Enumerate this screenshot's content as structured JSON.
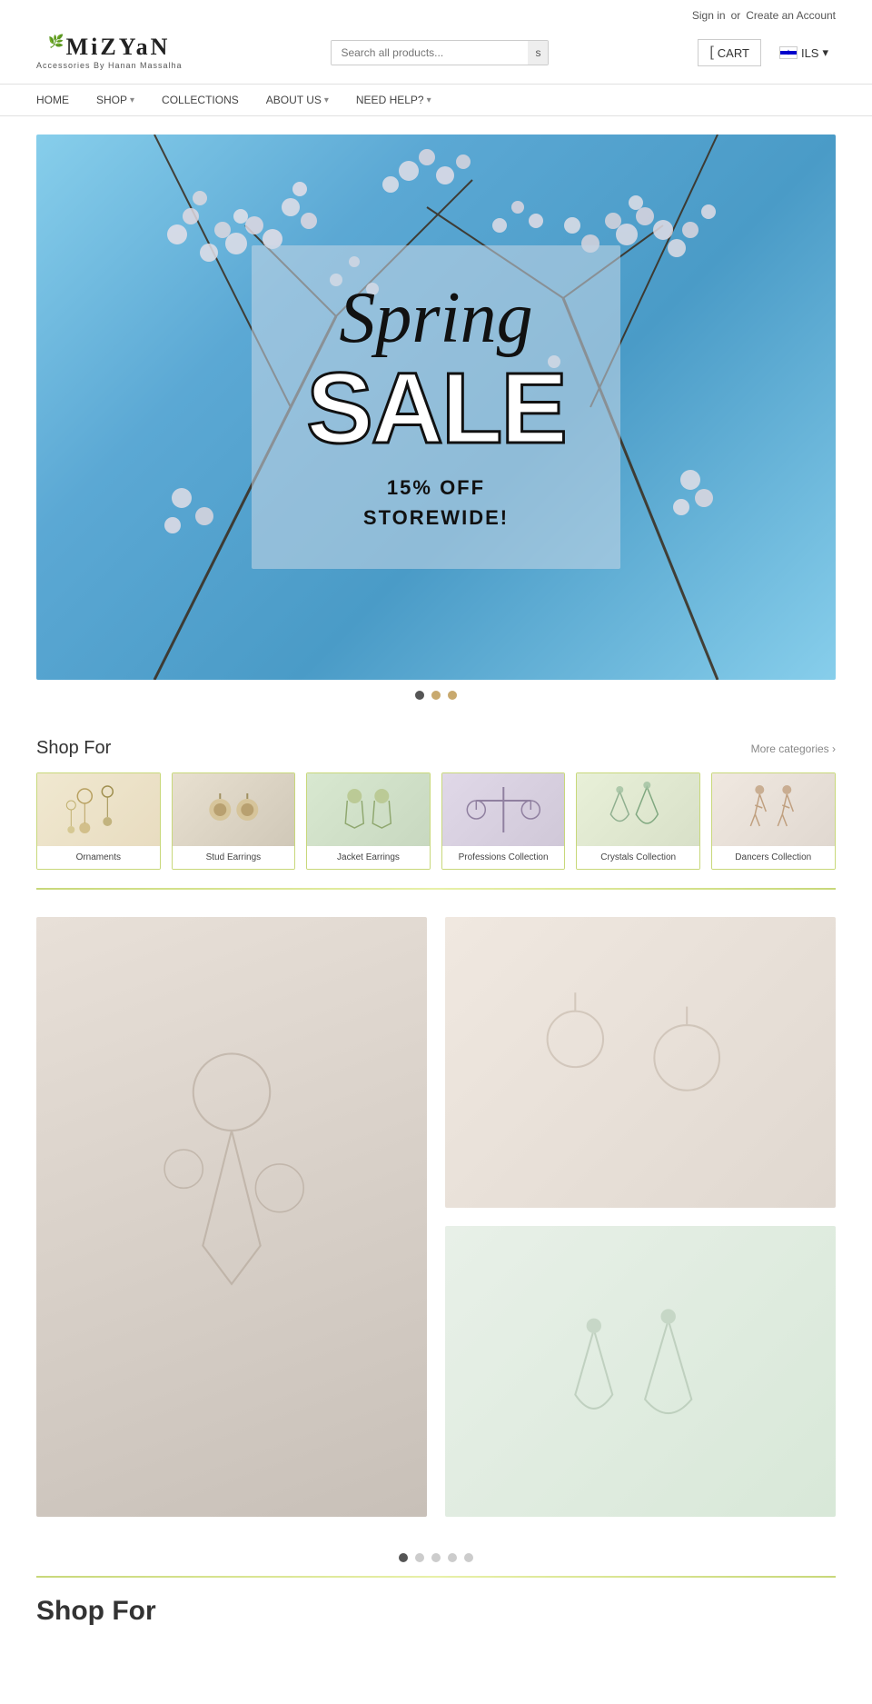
{
  "header": {
    "sign_in": "Sign in",
    "or": "or",
    "create_account": "Create an Account",
    "search_placeholder": "Search all products...",
    "search_btn": "s",
    "cart_label": "CART",
    "cart_bracket": "[",
    "lang_label": "ILS",
    "lang_arrow": "▾"
  },
  "logo": {
    "brand": "MiZYaN",
    "subtitle": "Accessories By Hanan Massalha",
    "leaf": "🌿"
  },
  "nav": {
    "items": [
      {
        "label": "HOME",
        "arrow": ""
      },
      {
        "label": "SHOP",
        "arrow": "▾"
      },
      {
        "label": "COLLECTIONS",
        "arrow": ""
      },
      {
        "label": "ABOUT US",
        "arrow": "▾"
      },
      {
        "label": "NEED HELP?",
        "arrow": "▾"
      }
    ]
  },
  "hero": {
    "spring": "Spring",
    "sale": "SALE",
    "discount_line1": "15% OFF",
    "discount_line2": "STOREWIDE!"
  },
  "hero_dots": [
    {
      "state": "active"
    },
    {
      "state": "accent"
    },
    {
      "state": "accent"
    }
  ],
  "shop_for": {
    "title": "Shop For",
    "more_link": "More categories ›",
    "categories": [
      {
        "label": "Ornaments",
        "class": "cat-ornaments",
        "icon": "✦"
      },
      {
        "label": "Stud Earrings",
        "class": "cat-stud",
        "icon": "◉"
      },
      {
        "label": "Jacket Earrings",
        "class": "cat-jacket",
        "icon": "✿"
      },
      {
        "label": "Professions Collection",
        "class": "cat-professions",
        "icon": "⚖"
      },
      {
        "label": "Crystals Collection",
        "class": "cat-crystals",
        "icon": "◈"
      },
      {
        "label": "Dancers Collection",
        "class": "cat-dancers",
        "icon": "♟"
      }
    ]
  },
  "bottom_dots": [
    {
      "state": "active"
    },
    {
      "state": "normal"
    },
    {
      "state": "normal"
    },
    {
      "state": "normal"
    },
    {
      "state": "normal"
    }
  ],
  "shop_bottom": {
    "title": "Shop For"
  }
}
